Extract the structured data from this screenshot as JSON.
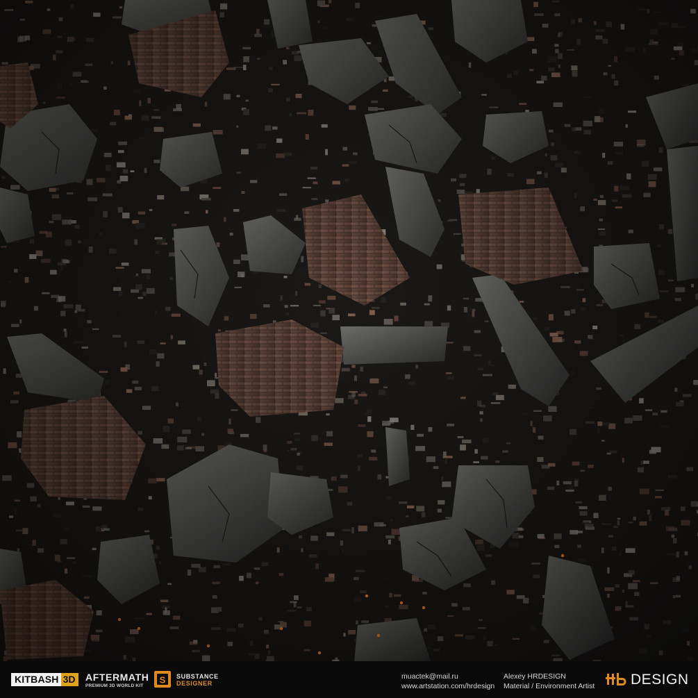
{
  "scene": {
    "subject": "rubble-field-top-down",
    "colors": {
      "ground": "#1a1816",
      "slab": "#4a4a4a",
      "slab_light": "#6b6b6b",
      "brick": "#6b4a3e",
      "brick_light": "#8a6553",
      "ember": "#ff8a2a"
    }
  },
  "footer": {
    "kitbash_text": "KITBASH",
    "kitbash_3d": "3D",
    "aftermath_title": "AFTERMATH",
    "aftermath_sub": "PREMIUM 3D WORLD KIT",
    "substance_line1": "SUBSTANCE",
    "substance_line2": "DESIGNER",
    "email": "muactek@mail.ru",
    "website": "www.artstation.com/hrdesign",
    "author_name": "Alexey HRDESIGN",
    "author_role": "Material / Environment Artist",
    "design_text": "DESIGN",
    "colors": {
      "kitbash_accent": "#e0a21b",
      "substance_accent": "#e08a1e"
    }
  }
}
